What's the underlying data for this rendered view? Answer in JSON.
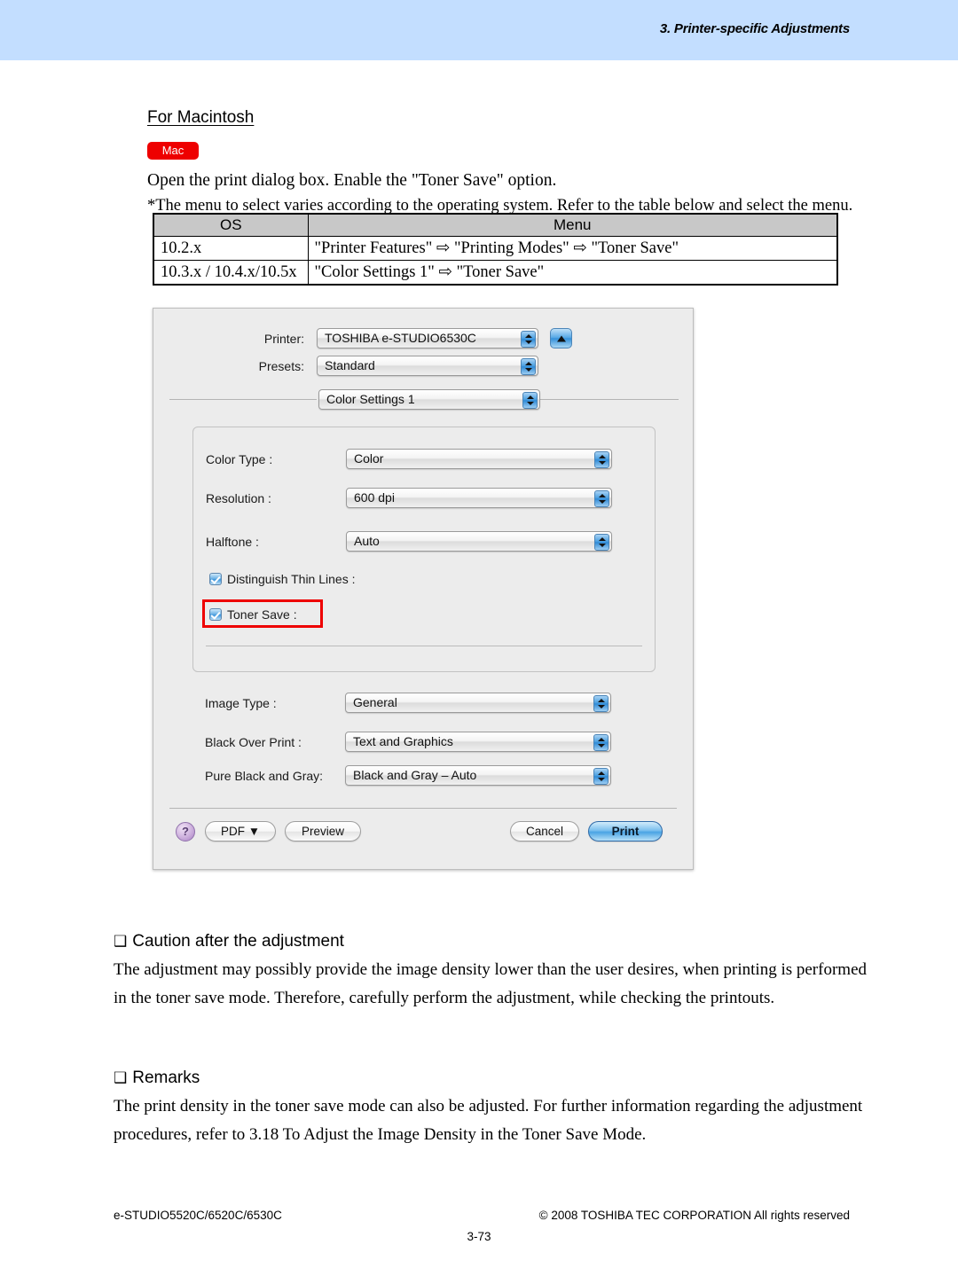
{
  "header": {
    "chapter_title": "3. Printer-specific Adjustments"
  },
  "section": {
    "title": "For Macintosh",
    "platform_badge": "Mac",
    "intro": "Open the print dialog box.  Enable the \"Toner Save\" option.",
    "note": "*The menu to select varies according to the operating system.  Refer to the table below and select the menu."
  },
  "os_table": {
    "columns": [
      "OS",
      "Menu"
    ],
    "rows": [
      [
        "10.2.x",
        "\"Printer Features\" ⇨ \"Printing Modes\" ⇨ \"Toner Save\""
      ],
      [
        "10.3.x / 10.4.x/10.5x",
        "\"Color Settings 1\" ⇨ \"Toner Save\""
      ]
    ]
  },
  "print_dialog": {
    "printer_label": "Printer:",
    "printer_value": "TOSHIBA e-STUDIO6530C",
    "presets_label": "Presets:",
    "presets_value": "Standard",
    "pane_value": "Color Settings 1",
    "options": [
      {
        "label": "Color Type :",
        "value": "Color"
      },
      {
        "label": "Resolution :",
        "value": "600 dpi"
      },
      {
        "label": "Halftone :",
        "value": "Auto"
      }
    ],
    "checkboxes": [
      {
        "label": "Distinguish Thin Lines :",
        "checked": true
      },
      {
        "label": "Toner Save :",
        "checked": true,
        "highlighted": true
      }
    ],
    "options2": [
      {
        "label": "Image Type :",
        "value": "General"
      },
      {
        "label": "Black Over Print :",
        "value": "Text and Graphics"
      },
      {
        "label": "Pure Black and Gray:",
        "value": "Black and Gray – Auto"
      }
    ],
    "buttons": {
      "help": "?",
      "pdf": "PDF ▼",
      "preview": "Preview",
      "cancel": "Cancel",
      "print": "Print"
    },
    "highlight_color": "#ee0000"
  },
  "caution": {
    "heading": "Caution after the adjustment",
    "line1": "The adjustment may possibly provide the image density lower than the user desires, when printing is performed",
    "line2": "in the toner save mode.  Therefore, carefully perform the adjustment, while checking the printouts."
  },
  "remarks": {
    "heading": "Remarks",
    "line1": "The print density in the toner save mode can also be adjusted.  For further information regarding the adjustment",
    "line2": "procedures, refer to 3.18 To Adjust the Image Density in the Toner Save Mode."
  },
  "footer": {
    "model": "e-STUDIO5520C/6520C/6530C",
    "copyright": "© 2008 TOSHIBA TEC CORPORATION All rights reserved",
    "page_number": "3-73"
  }
}
